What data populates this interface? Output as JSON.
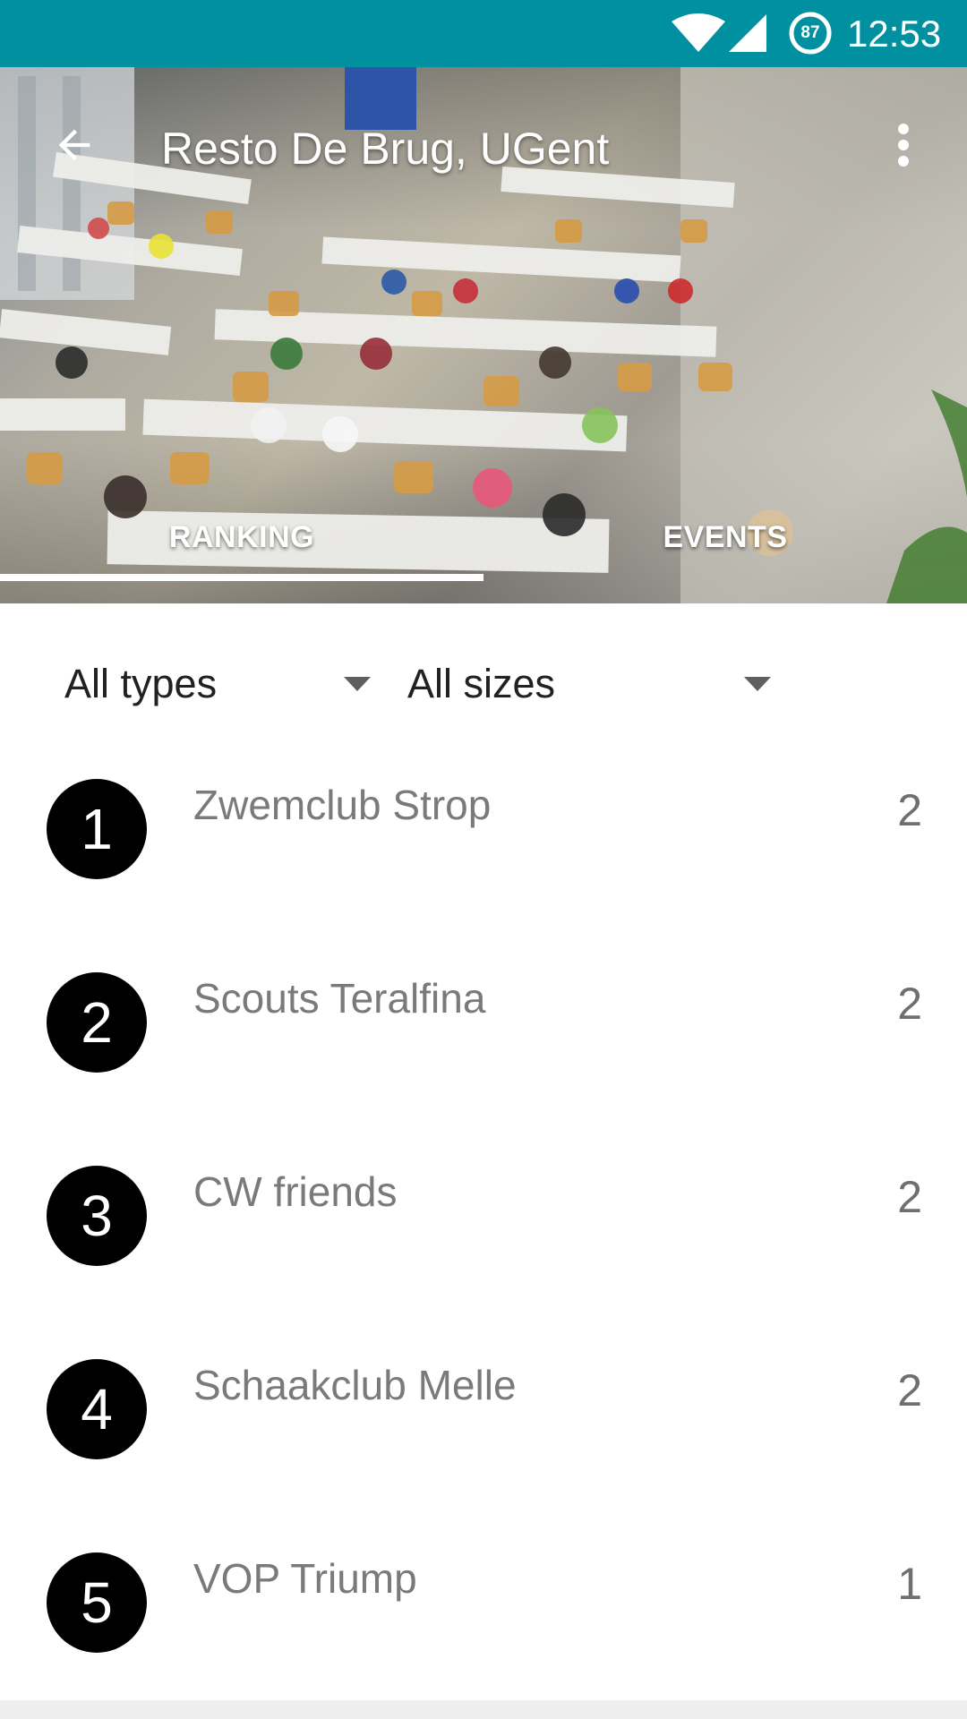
{
  "status_bar": {
    "battery_level": "87",
    "time": "12:53",
    "bar_color": "#00909f"
  },
  "toolbar": {
    "title": "Resto De Brug, UGent",
    "back_icon": "arrow-back-icon",
    "menu_icon": "more-vert-icon"
  },
  "tabs": [
    {
      "label": "RANKING",
      "selected": true
    },
    {
      "label": "EVENTS",
      "selected": false
    }
  ],
  "filters": {
    "type": "All types",
    "size": "All sizes"
  },
  "ranking": [
    {
      "rank": "1",
      "name": "Zwemclub Strop",
      "score": "2"
    },
    {
      "rank": "2",
      "name": "Scouts Teralfina",
      "score": "2"
    },
    {
      "rank": "3",
      "name": "CW friends",
      "score": "2"
    },
    {
      "rank": "4",
      "name": "Schaakclub Melle",
      "score": "2"
    },
    {
      "rank": "5",
      "name": "VOP Triump",
      "score": "1"
    }
  ]
}
